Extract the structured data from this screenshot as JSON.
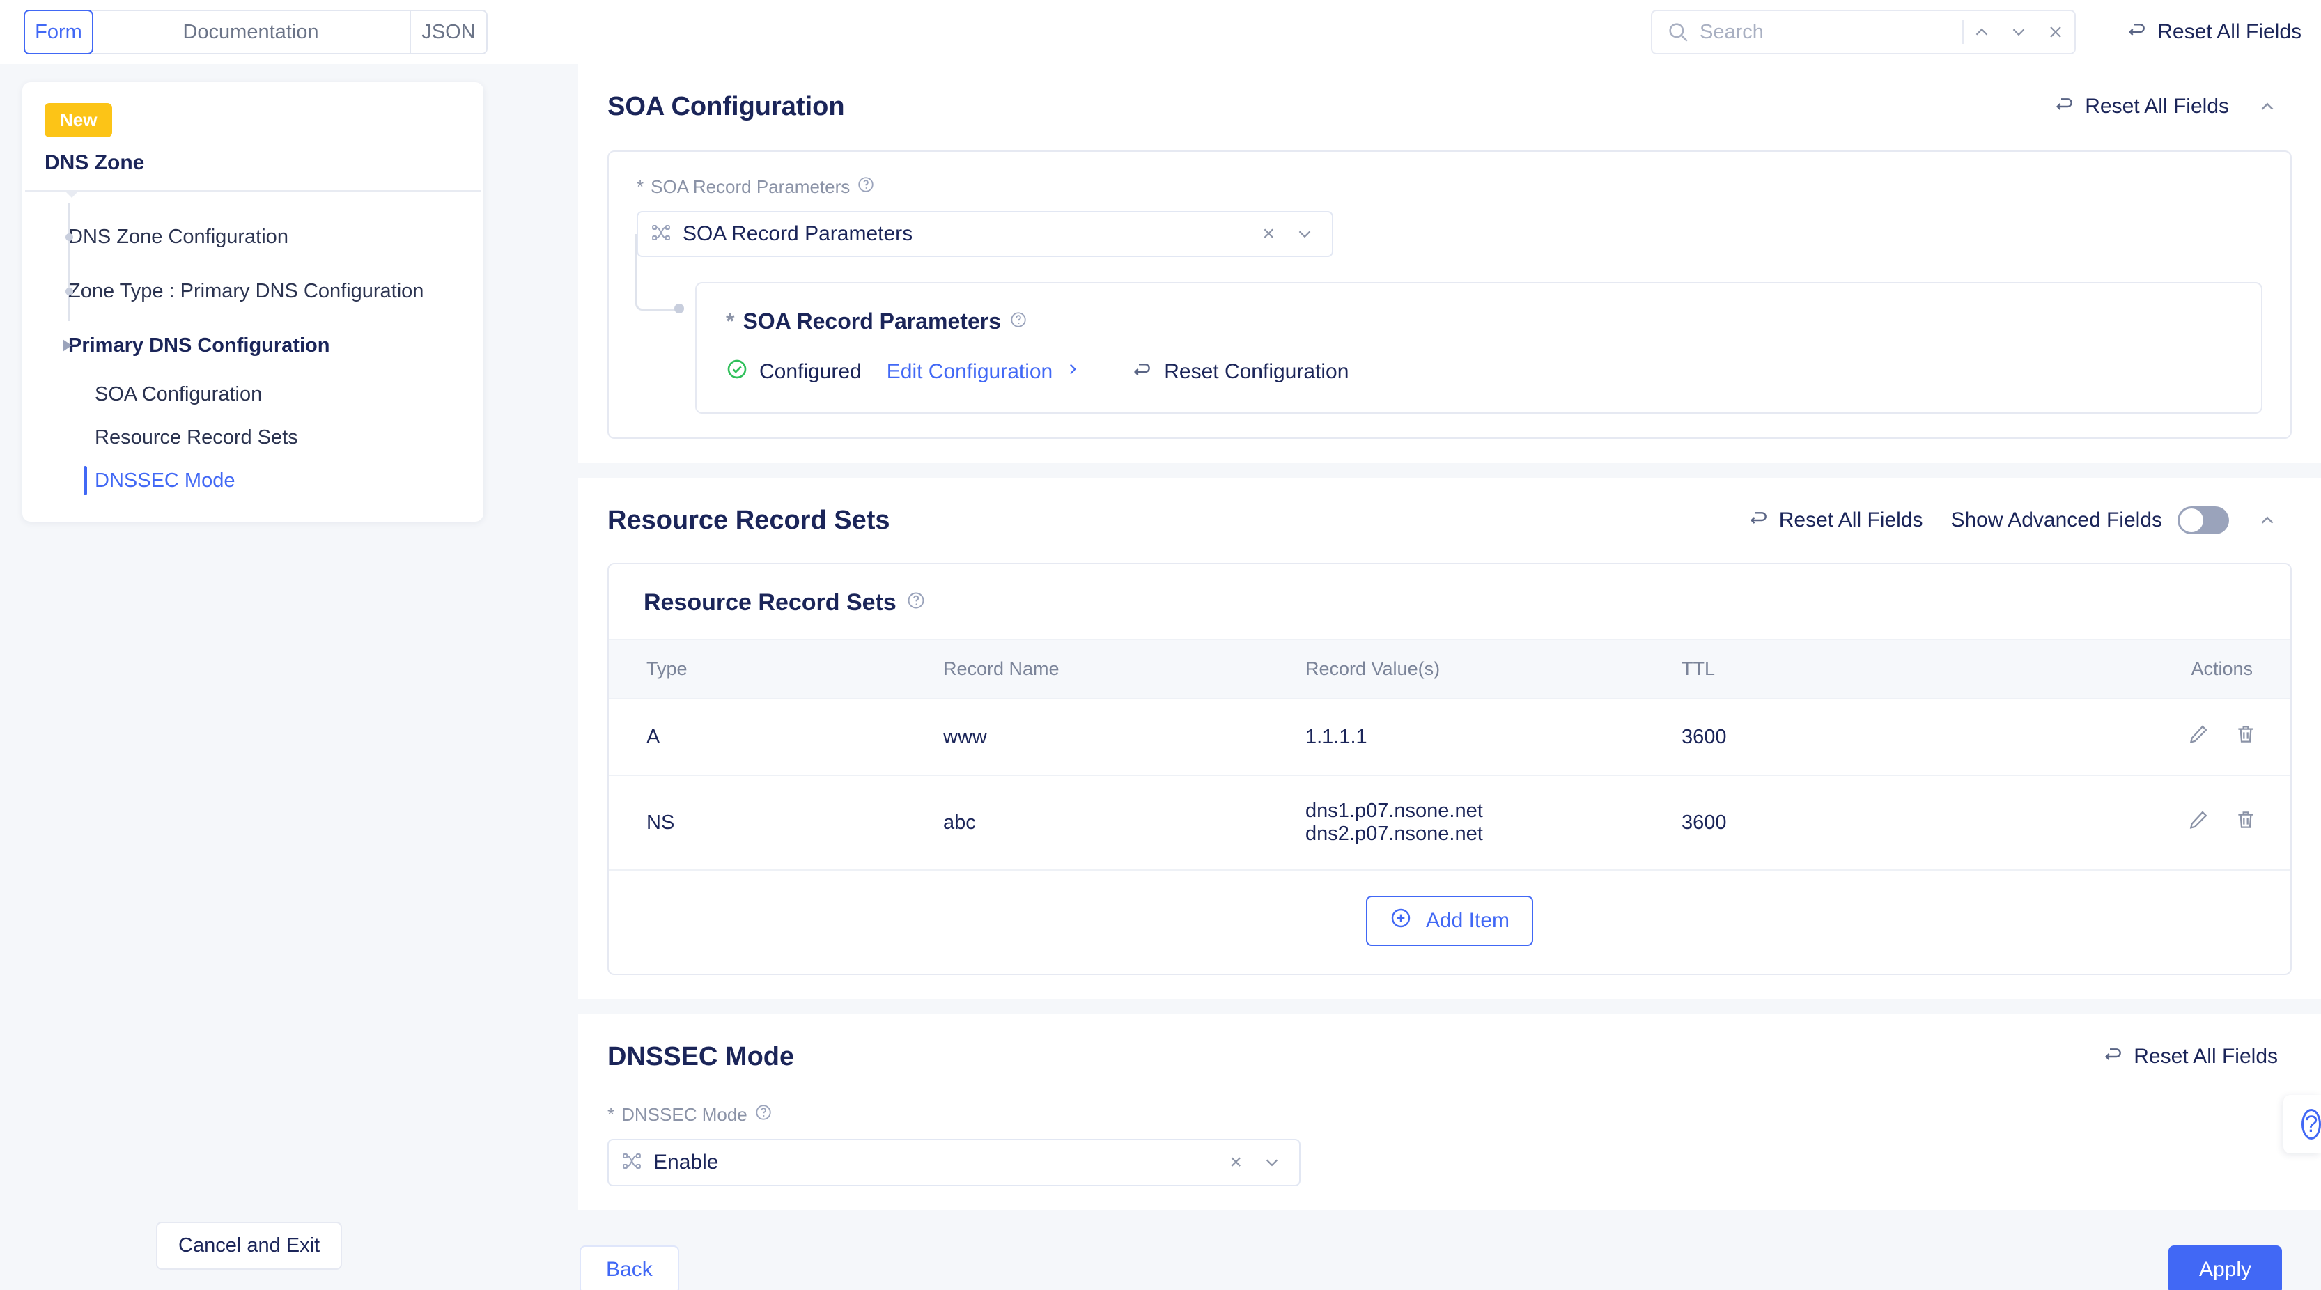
{
  "topbar": {
    "tabs": [
      {
        "label": "Form",
        "active": true
      },
      {
        "label": "Documentation",
        "active": false
      },
      {
        "label": "JSON",
        "active": false
      }
    ],
    "search": {
      "placeholder": "Search",
      "value": ""
    },
    "reset_all_label": "Reset All Fields"
  },
  "sidebar": {
    "badge": "New",
    "title": "DNS Zone",
    "tree": [
      {
        "label": "DNS Zone Configuration",
        "marker": "dot",
        "bold": false
      },
      {
        "label": "Zone Type : Primary DNS Configuration",
        "marker": "dot",
        "bold": false
      },
      {
        "label": "Primary DNS Configuration",
        "marker": "arrow",
        "bold": true
      }
    ],
    "subitems": [
      {
        "label": "SOA Configuration",
        "selected": false
      },
      {
        "label": "Resource Record Sets",
        "selected": false
      },
      {
        "label": "DNSSEC Mode",
        "selected": true
      }
    ],
    "cancel_label": "Cancel and Exit"
  },
  "soa": {
    "title": "SOA Configuration",
    "reset_label": "Reset All Fields",
    "field_label": "SOA Record Parameters",
    "required_mark": "*",
    "select_value": "SOA Record Parameters",
    "clear_glyph": "×",
    "nested_label": "SOA Record Parameters",
    "status_label": "Configured",
    "edit_label": "Edit Configuration",
    "reset_config_label": "Reset Configuration"
  },
  "rrs": {
    "title": "Resource Record Sets",
    "reset_label": "Reset All Fields",
    "advanced_label": "Show Advanced Fields",
    "advanced_on": false,
    "panel_title": "Resource Record Sets",
    "columns": [
      "Type",
      "Record Name",
      "Record Value(s)",
      "TTL",
      "Actions"
    ],
    "rows": [
      {
        "type": "A",
        "name": "www",
        "values": [
          "1.1.1.1"
        ],
        "ttl": "3600"
      },
      {
        "type": "NS",
        "name": "abc",
        "values": [
          "dns1.p07.nsone.net",
          "dns2.p07.nsone.net"
        ],
        "ttl": "3600"
      }
    ],
    "add_item_label": "Add Item"
  },
  "dnssec": {
    "title": "DNSSEC Mode",
    "reset_label": "Reset All Fields",
    "field_label": "DNSSEC Mode",
    "required_mark": "*",
    "select_value": "Enable",
    "clear_glyph": "×"
  },
  "footer": {
    "back_label": "Back",
    "apply_label": "Apply"
  },
  "colors": {
    "accent": "#4168f5",
    "badge": "#fcc417",
    "success": "#2fc05a",
    "text_dark": "#1b2559",
    "muted": "#8b93a7",
    "page_bg": "#f5f7fa"
  }
}
